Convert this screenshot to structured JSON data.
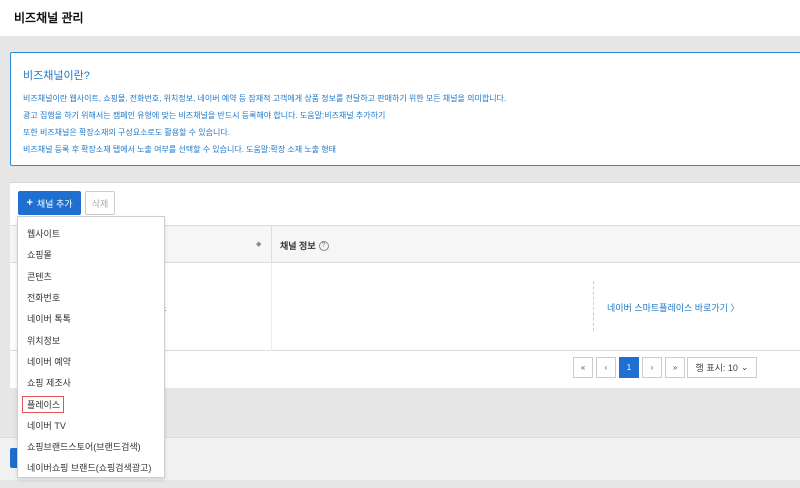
{
  "page": {
    "title": "비즈채널 관리"
  },
  "info": {
    "title": "비즈채널이란?",
    "lines": [
      "비즈채널이란 웹사이트, 쇼핑몰, 전화번호, 위치정보, 네이버 예약 등 잠재적 고객에게 상품 정보를 전달하고 판매하기 위한 모든 채널을 의미합니다.",
      "광고 집행을 하기 위해서는 캠페인 유형에 맞는 비즈채널을 반드시 등록해야 합니다. 도움말:비즈채널 추가하기",
      "또한 비즈채널은 확장소재의 구성요소로도 활용할 수 있습니다.",
      "비즈채널 등록 후 확장소재 탭에서 노출 여부를 선택할 수 있습니다. 도움말:확장 소재 노출 형태"
    ]
  },
  "toolbar": {
    "add_label": "채널 추가",
    "delete_label": "삭제"
  },
  "table": {
    "col_info": "채널 정보",
    "row": {
      "name_fragment": "스",
      "link": "네이버 스마트플레이스 바로가기 〉"
    }
  },
  "pagination": {
    "first": "«",
    "prev": "‹",
    "current": "1",
    "next": "›",
    "last": "»",
    "page_size": "행 표시: 10"
  },
  "dropdown": {
    "items": [
      "웹사이트",
      "쇼핑몰",
      "콘텐츠",
      "전화번호",
      "네이버 톡톡",
      "위치정보",
      "네이버 예약",
      "쇼핑 제조사",
      "플레이스",
      "네이버 TV",
      "쇼핑브랜드스토어(브랜드검색)",
      "네이버쇼핑 브랜드(쇼핑검색광고)"
    ],
    "highlighted_index": 8
  },
  "colors": {
    "accent": "#1f6fd0",
    "info_text": "#1d78c8",
    "highlight_border": "#e25555"
  }
}
